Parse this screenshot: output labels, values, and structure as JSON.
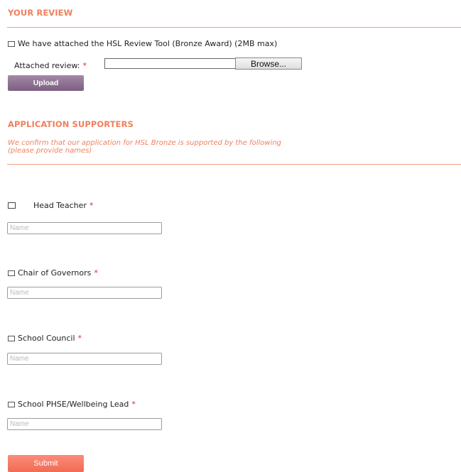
{
  "review": {
    "title": "YOUR REVIEW",
    "checkbox_label": "We have attached the HSL Review Tool (Bronze Award) (2MB max)",
    "attached_label": "Attached review:",
    "required_mark": "*",
    "browse_label": "Browse...",
    "upload_label": "Upload"
  },
  "supporters": {
    "title": "APPLICATION SUPPORTERS",
    "note_line1": "We confirm that our application for HSL Bronze is supported by the following",
    "note_line2": "(please provide names)",
    "items": [
      {
        "label": "Head Teacher",
        "required": "*",
        "placeholder": "Name"
      },
      {
        "label": "Chair of Governors",
        "required": "*",
        "placeholder": "Name"
      },
      {
        "label": "School Council",
        "required": "*",
        "placeholder": "Name"
      },
      {
        "label": "School PHSE/Wellbeing Lead",
        "required": "*",
        "placeholder": "Name"
      }
    ]
  },
  "submit_label": "Submit",
  "colors": {
    "accent": "#f07f5e",
    "required": "#e3282b",
    "upload": "#8a6d8e",
    "submit": "#f47a63"
  }
}
